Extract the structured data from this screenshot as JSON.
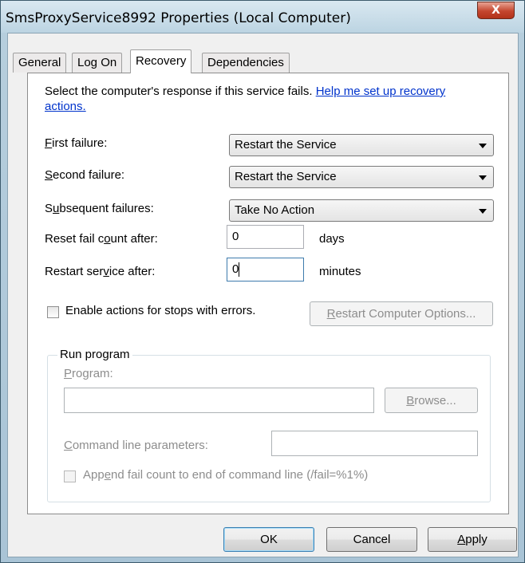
{
  "window": {
    "title": "SmsProxyService8992 Properties (Local Computer)",
    "close_glyph": "X"
  },
  "tabs": [
    {
      "label": "General"
    },
    {
      "label": "Log On"
    },
    {
      "label": "Recovery"
    },
    {
      "label": "Dependencies"
    }
  ],
  "recovery": {
    "intro_text": "Select the computer's response if this service fails.",
    "help_link_part1": "Help me set up recovery",
    "help_link_part2": "actions.",
    "first_failure": {
      "label_access_key": "F",
      "label_rest": "irst failure:",
      "value": "Restart the Service"
    },
    "second_failure": {
      "label_access_key": "S",
      "label_rest": "econd failure:",
      "value": "Restart the Service"
    },
    "subsequent_failures": {
      "label_pre": "S",
      "label_access_key": "u",
      "label_rest": "bsequent failures:",
      "value": "Take No Action"
    },
    "reset_fail_count": {
      "label_pre": "Reset fail c",
      "label_access_key": "o",
      "label_rest": "unt after:",
      "value": "0",
      "unit": "days"
    },
    "restart_service": {
      "label_pre": "Restart ser",
      "label_access_key": "v",
      "label_rest": "ice after:",
      "value": "0",
      "unit": "minutes"
    },
    "enable_actions": {
      "label": "Enable actions for stops with errors.",
      "checked": false
    },
    "restart_computer_options": {
      "access_key": "R",
      "rest": "estart Computer Options..."
    },
    "run_program": {
      "legend": "Run program",
      "program_label_access_key": "P",
      "program_label_rest": "rogram:",
      "program_value": "",
      "browse_access_key": "B",
      "browse_rest": "rowse...",
      "cmd_params_label_access_key": "C",
      "cmd_params_label_rest": "ommand line parameters:",
      "cmd_params_value": "",
      "append_pre": "App",
      "append_access_key": "e",
      "append_rest": "nd fail count to end of command line (/fail=%1%)",
      "append_checked": false
    }
  },
  "buttons": {
    "ok": "OK",
    "cancel": "Cancel",
    "apply_access_key": "A",
    "apply_rest": "pply"
  },
  "colors": {
    "link": "#0033cc",
    "close_button": "#c4462e",
    "disabled_text": "#8d8d8d"
  }
}
